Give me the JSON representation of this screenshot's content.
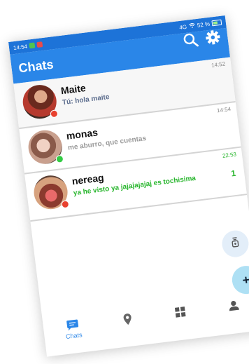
{
  "status": {
    "time": "14:54",
    "network": "4G",
    "battery": "52 %"
  },
  "appbar": {
    "title": "Chats",
    "search_icon": "search-icon",
    "settings_icon": "gear-icon"
  },
  "chats": [
    {
      "name": "Maite",
      "message": "Tú: hola maite",
      "time": "14:52",
      "unread": "",
      "status_color": "#e8412f",
      "message_color": "#5a6b8c",
      "highlight": true
    },
    {
      "name": "monas",
      "message": "me aburro, que cuentas",
      "time": "14:54",
      "unread": "",
      "status_color": "#33cc44",
      "message_color": "#9a9a9a",
      "highlight": false
    },
    {
      "name": "nereag",
      "message": "ya he visto ya jajajajajaj es tochisima",
      "time": "22:53",
      "unread": "1",
      "status_color": "#e8412f",
      "message_color": "#26b52b",
      "highlight": false
    }
  ],
  "fab": {
    "small_icon": "game-icon",
    "add_label": "+"
  },
  "nav": {
    "chats_label": "Chats",
    "map_icon": "location-pin-icon",
    "grid_icon": "grid-icon",
    "profile_icon": "person-icon"
  },
  "colors": {
    "primary": "#2a86e8",
    "statusbar": "#1d73d8",
    "unread": "#26b52b"
  }
}
